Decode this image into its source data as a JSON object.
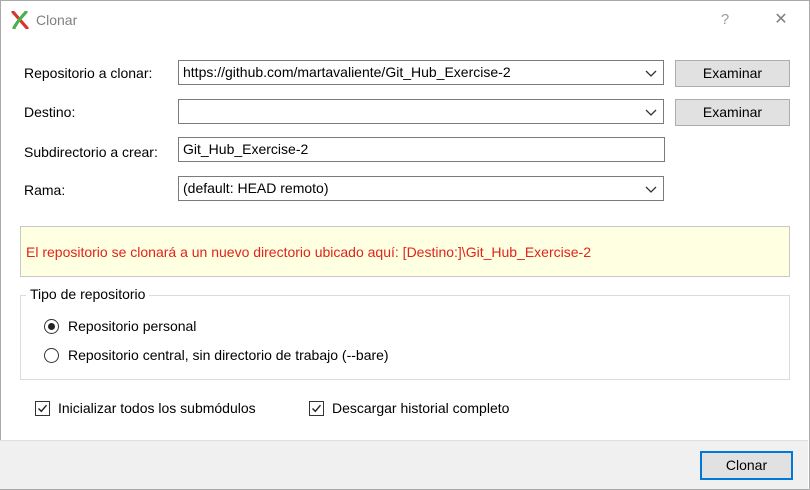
{
  "window": {
    "title": "Clonar",
    "help_glyph": "?",
    "close_glyph": "✕"
  },
  "form": {
    "repo_label": "Repositorio a clonar:",
    "repo_value": "https://github.com/martavaliente/Git_Hub_Exercise-2",
    "dest_label": "Destino:",
    "dest_value": "",
    "subdir_label": "Subdirectorio a crear:",
    "subdir_value": "Git_Hub_Exercise-2",
    "branch_label": "Rama:",
    "branch_value": "(default: HEAD remoto)",
    "browse_label": "Examinar"
  },
  "notice": "El repositorio se clonará a un nuevo directorio ubicado aquí: [Destino:]\\Git_Hub_Exercise-2",
  "repo_type": {
    "title": "Tipo de repositorio",
    "options": [
      {
        "label": "Repositorio personal",
        "selected": true
      },
      {
        "label": "Repositorio central, sin directorio de trabajo (--bare)",
        "selected": false
      }
    ]
  },
  "options": {
    "init_submodules_label": "Inicializar todos los submódulos",
    "init_submodules_checked": true,
    "full_history_label": "Descargar historial completo",
    "full_history_checked": true
  },
  "footer": {
    "clone_label": "Clonar"
  },
  "colors": {
    "notice_text": "#e0241c",
    "notice_bg": "#ffffe1",
    "focus_border": "#0078d7"
  }
}
